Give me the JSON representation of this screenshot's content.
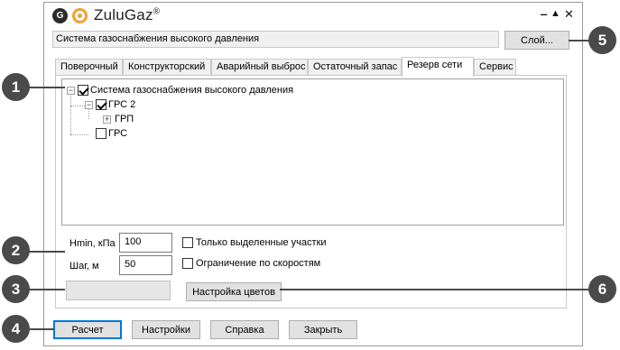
{
  "app": {
    "name": "ZuluGaz",
    "trademark": "®",
    "logo_letter": "G",
    "minimize_glyph": "‒",
    "maximize_glyph": "▲",
    "close_glyph": "✕"
  },
  "path_field": {
    "value": "Система газоснабжения высокого давления"
  },
  "layer_button": {
    "label": "Слой..."
  },
  "tabs": [
    {
      "label": "Поверочный",
      "active": false
    },
    {
      "label": "Конструкторский",
      "active": false
    },
    {
      "label": "Аварийный выброс",
      "active": false
    },
    {
      "label": "Остаточный запас",
      "active": false
    },
    {
      "label": "Резерв сети",
      "active": true
    },
    {
      "label": "Сервис",
      "active": false
    }
  ],
  "tree": {
    "items": [
      {
        "label": "Система газоснабжения высокого давления",
        "checked": true,
        "expander": "−"
      },
      {
        "label": "ГРС 2",
        "checked": true,
        "expander": "−"
      },
      {
        "label": "ГРП",
        "expander": "+"
      },
      {
        "label": "ГРС",
        "checked": false
      }
    ]
  },
  "fields": {
    "hmin_label": "Hmin, кПа",
    "hmin_value": "100",
    "step_label": "Шаг, м",
    "step_value": "50"
  },
  "options": {
    "only_selected": {
      "label": "Только выделенные участки",
      "checked": false
    },
    "speed_limit": {
      "label": "Ограничение по скоростям",
      "checked": false
    }
  },
  "color_settings_button": {
    "label": "Настройка цветов"
  },
  "bottom_buttons": {
    "calculate": "Расчет",
    "settings": "Настройки",
    "help": "Справка",
    "close": "Закрыть"
  },
  "callouts": [
    "1",
    "2",
    "3",
    "4",
    "5",
    "6"
  ],
  "colors": {
    "callout": "#4a4a4a",
    "logo_ring": "#f0a030",
    "focus": "#0078d7"
  }
}
